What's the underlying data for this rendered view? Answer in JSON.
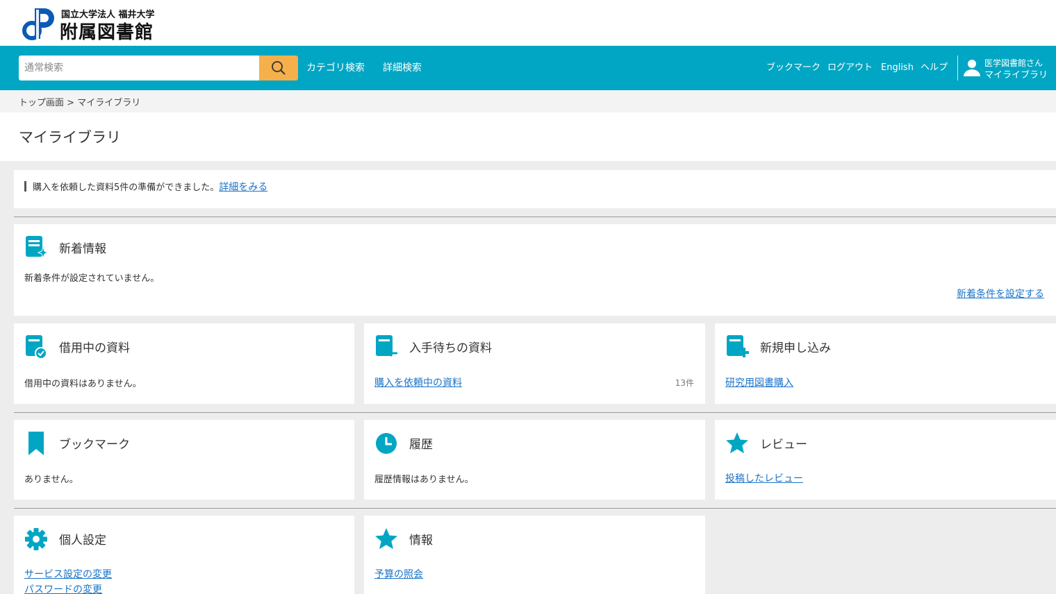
{
  "header": {
    "logo_sub": "国立大学法人 福井大学",
    "logo_main": "附属図書館",
    "search_placeholder": "通常検索",
    "nav_links": [
      "カテゴリ検索",
      "詳細検索"
    ],
    "util_links": [
      "ブックマーク",
      "ログアウト",
      "English",
      "ヘルプ"
    ],
    "user_name": "医学図書館さん",
    "user_library": "マイライブラリ"
  },
  "breadcrumb": {
    "home": "トップ画面",
    "sep": ">",
    "current": "マイライブラリ"
  },
  "page_title": "マイライブラリ",
  "notice": {
    "text": "購入を依頼した資料5件の準備ができました。",
    "link": "詳細をみる"
  },
  "new_info": {
    "title": "新着情報",
    "text": "新着条件が設定されていません。",
    "link": "新着条件を設定する"
  },
  "cards": {
    "borrowing": {
      "title": "借用中の資料",
      "text": "借用中の資料はありません。"
    },
    "waiting": {
      "title": "入手待ちの資料",
      "link": "購入を依頼中の資料",
      "count": "13件"
    },
    "request": {
      "title": "新規申し込み",
      "link": "研究用図書購入"
    },
    "bookmark": {
      "title": "ブックマーク",
      "text": "ありません。"
    },
    "history": {
      "title": "履歴",
      "text": "履歴情報はありません。"
    },
    "review": {
      "title": "レビュー",
      "link": "投稿したレビュー"
    },
    "settings": {
      "title": "個人設定",
      "links": [
        "サービス設定の変更",
        "パスワードの変更"
      ]
    },
    "info": {
      "title": "情報",
      "link": "予算の照会"
    }
  },
  "colors": {
    "teal": "#00a6c3",
    "orange": "#f5b04b",
    "link": "#1a73c8",
    "logo_blue": "#0a5bb5"
  }
}
